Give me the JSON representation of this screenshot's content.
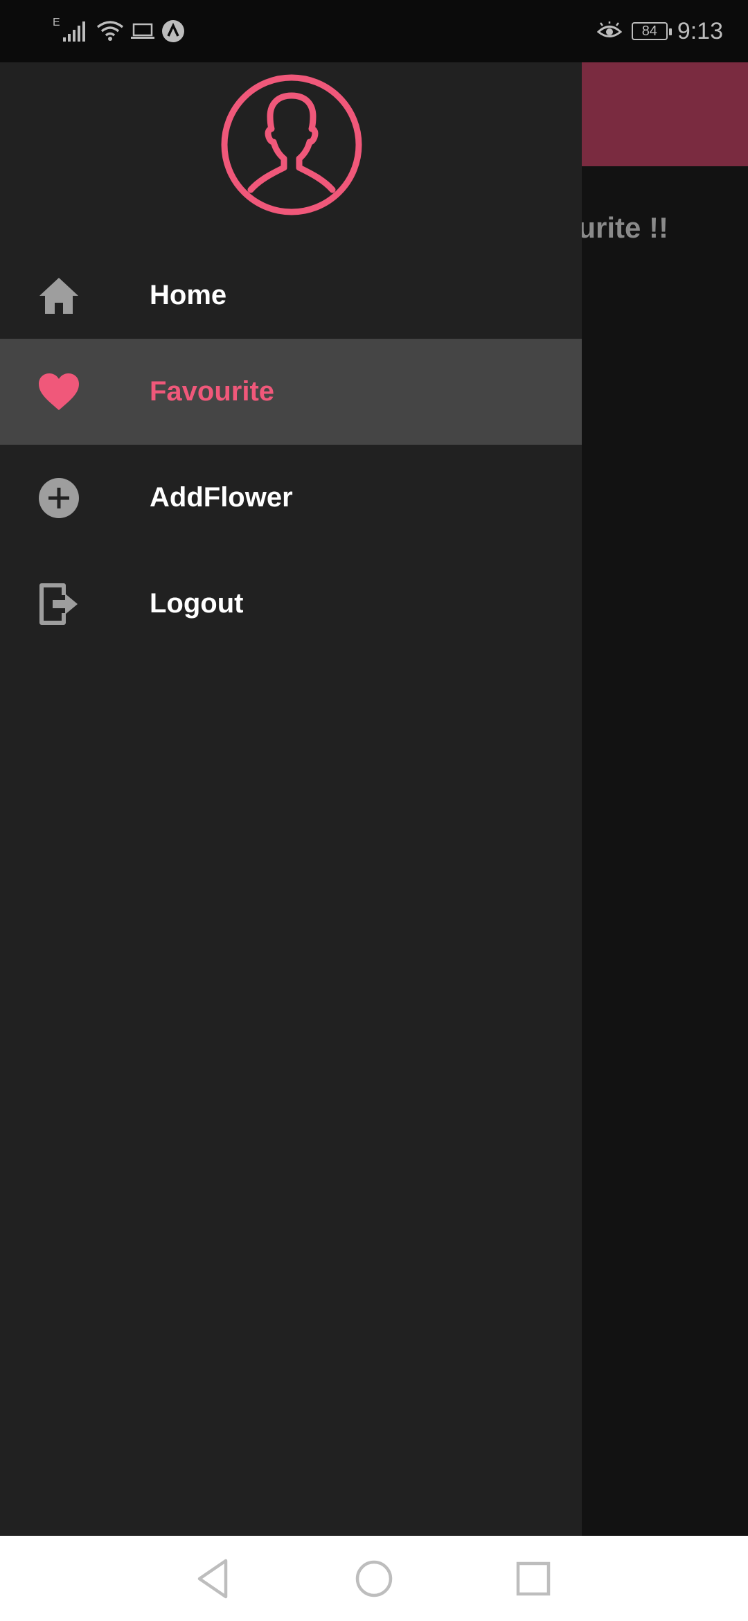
{
  "status_bar": {
    "network_type": "E",
    "battery": "84",
    "time": "9:13",
    "icons": [
      "signal-icon",
      "wifi-icon",
      "laptop-icon",
      "app-notification-icon",
      "eye-comfort-icon",
      "battery-icon"
    ]
  },
  "background_page": {
    "title_fragment": "urite !!",
    "appbar_color": "#7a2b40"
  },
  "drawer": {
    "avatar_icon": "user-avatar-icon",
    "accent_color": "#f0587a",
    "items": [
      {
        "label": "Home",
        "icon": "home-icon",
        "active": false
      },
      {
        "label": "Favourite",
        "icon": "heart-icon",
        "active": true
      },
      {
        "label": "AddFlower",
        "icon": "add-circle-icon",
        "active": false
      },
      {
        "label": "Logout",
        "icon": "logout-icon",
        "active": false
      }
    ]
  },
  "nav_bar": {
    "buttons": [
      "back-icon",
      "home-circle-icon",
      "recents-icon"
    ]
  }
}
